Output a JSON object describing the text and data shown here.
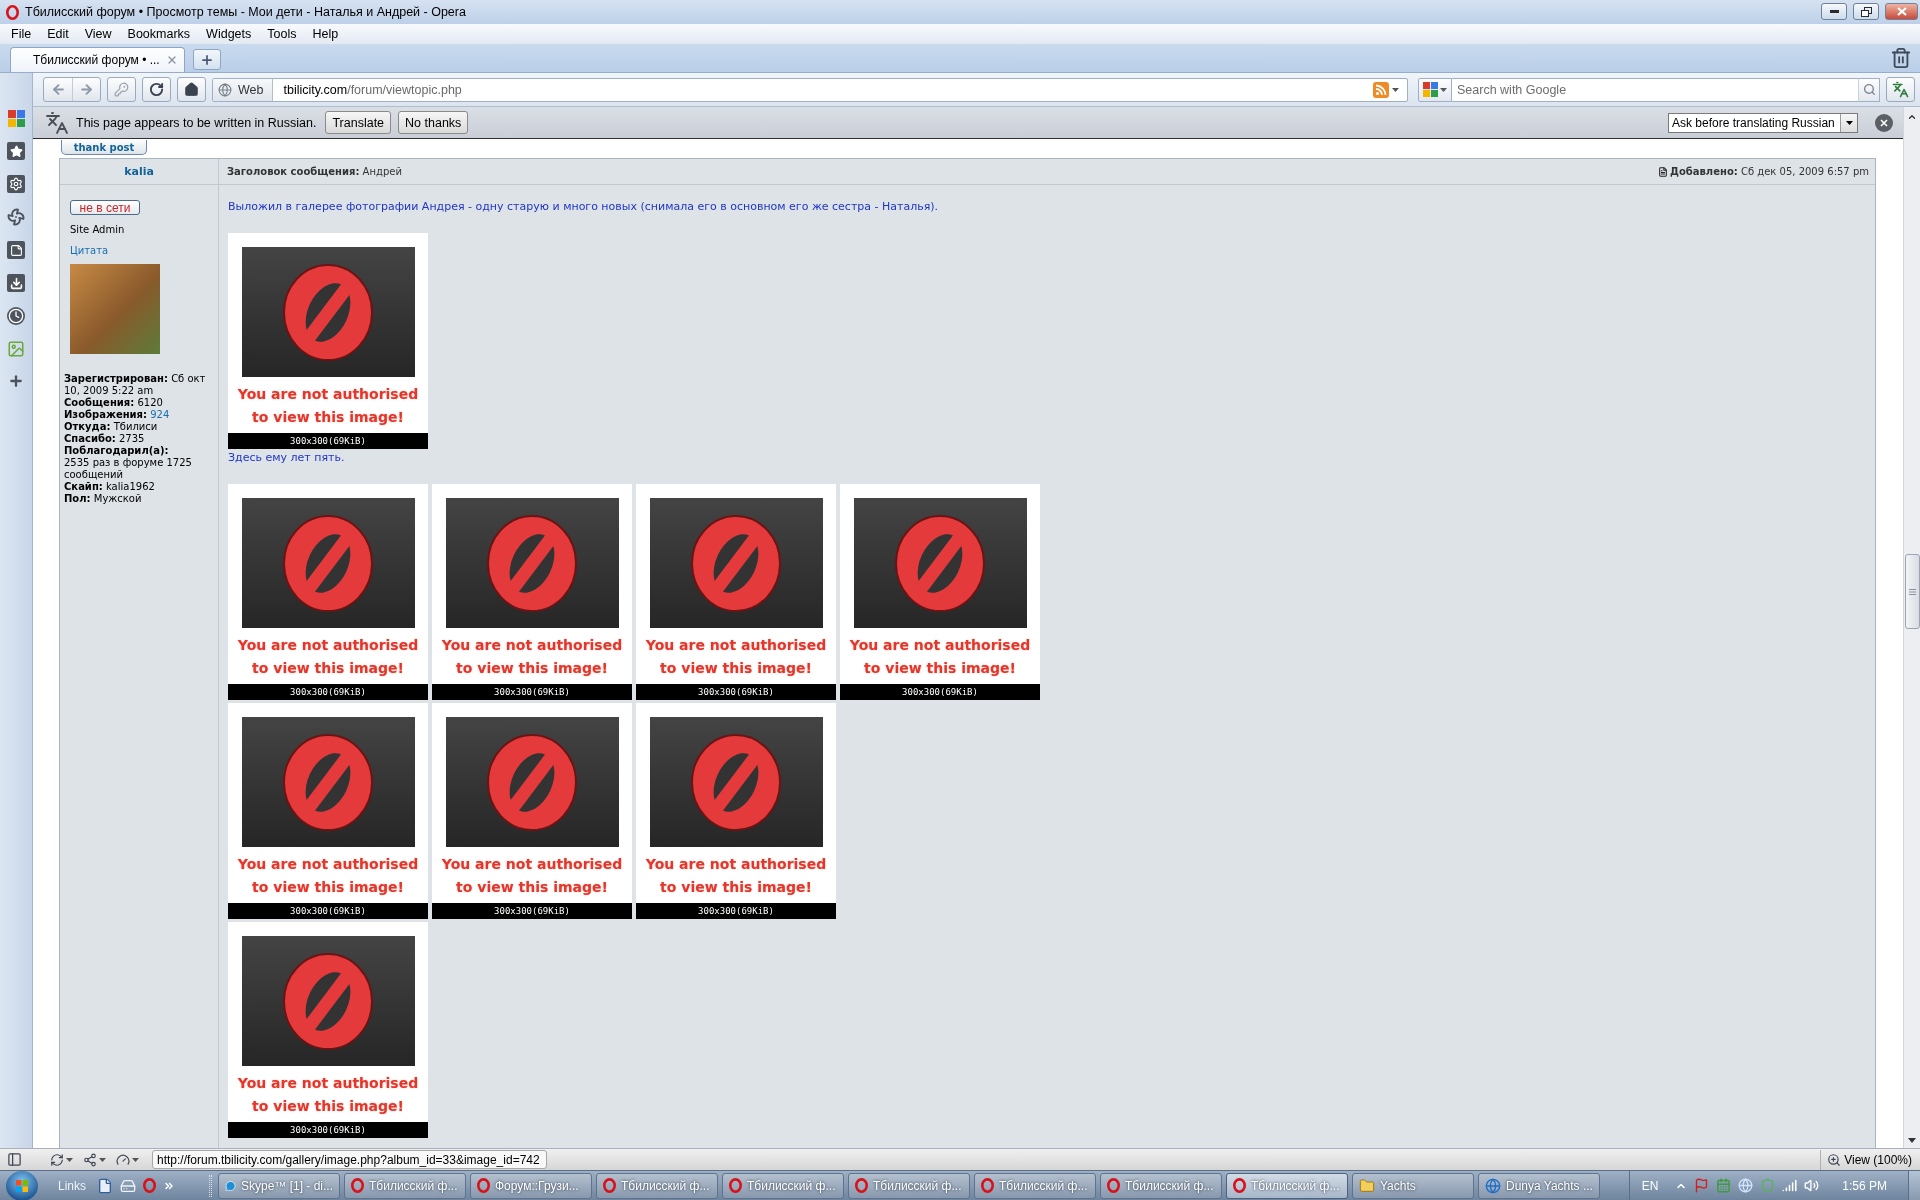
{
  "window": {
    "title": "Тбилисский форум • Просмотр темы - Мои дети - Наталья и Андрей - Opera"
  },
  "menu": [
    "File",
    "Edit",
    "View",
    "Bookmarks",
    "Widgets",
    "Tools",
    "Help"
  ],
  "tabs": [
    {
      "label": "Тбилисский форум • ...",
      "selected": true
    }
  ],
  "address_bar": {
    "badge": "Web",
    "domain": "tbilicity.com",
    "path": "/forum/viewtopic.php"
  },
  "search": {
    "placeholder": "Search with Google"
  },
  "translate_bar": {
    "message": "This page appears to be written in Russian.",
    "buttons": [
      "Translate",
      "No thanks"
    ],
    "option": "Ask before translating Russian"
  },
  "post": {
    "thank_button": "thank post",
    "author": "kalia",
    "status": "не в сети",
    "rank": "Site Admin",
    "quote": "Цитата",
    "stats": [
      {
        "kind": "inline",
        "label": "Зарегистрирован:",
        "value": "Сб окт 10, 2009 5:22 am"
      },
      {
        "kind": "inline",
        "label": "Сообщения:",
        "value": "6120"
      },
      {
        "kind": "link",
        "label": "Изображения:",
        "value": "924"
      },
      {
        "kind": "inline",
        "label": "Откуда:",
        "value": "Тбилиси"
      },
      {
        "kind": "inline",
        "label": "Спасибо:",
        "value": "2735"
      },
      {
        "kind": "block",
        "label": "Поблагодарил(а):",
        "value": "2535 раз в форуме 1725 сообщений"
      },
      {
        "kind": "inline",
        "label": "Скайп:",
        "value": "kalia1962"
      },
      {
        "kind": "inline",
        "label": "Пол:",
        "value": "Мужской"
      }
    ],
    "subject": "**Заголовок сообщения:** Андрей",
    "posted": "**Добавлено:** Сб дек 05, 2009 6:57 pm",
    "body": [
      {
        "kind": "text",
        "text": "Выложил в галерее фотографии Андрея - одну старую и много новых (снимала его в основном его же сестра - Наталья)."
      },
      {
        "kind": "gallery",
        "rows": [
          [
            {
              "notice": "You are not authorised to view this image!",
              "caption": "300x300(69KiB)"
            }
          ]
        ]
      },
      {
        "kind": "text",
        "text": "Здесь ему лет пять."
      },
      {
        "kind": "gallery",
        "rows": [
          [
            {
              "notice": "You are not authorised to view this image!",
              "caption": "300x300(69KiB)"
            },
            {
              "notice": "You are not authorised to view this image!",
              "caption": "300x300(69KiB)"
            },
            {
              "notice": "You are not authorised to view this image!",
              "caption": "300x300(69KiB)"
            },
            {
              "notice": "You are not authorised to view this image!",
              "caption": "300x300(69KiB)"
            }
          ],
          [
            {
              "notice": "You are not authorised to view this image!",
              "caption": "300x300(69KiB)"
            },
            {
              "notice": "You are not authorised to view this image!",
              "caption": "300x300(69KiB)"
            },
            {
              "notice": "You are not authorised to view this image!",
              "caption": "300x300(69KiB)"
            }
          ],
          [
            {
              "notice": "You are not authorised to view this image!",
              "caption": "300x300(69KiB)"
            }
          ]
        ]
      }
    ]
  },
  "status_bar": {
    "url": "http://forum.tbilicity.com/gallery/image.php?album_id=33&image_id=742",
    "zoom": "View (100%)"
  },
  "taskbar": {
    "links": "Links",
    "tasks": [
      {
        "label": "Skype™ [1] - di...",
        "kind": "chat",
        "selected": false
      },
      {
        "label": "Тбилисский ф...",
        "kind": "browser",
        "selected": false
      },
      {
        "label": "Форум::Грузи...",
        "kind": "browser",
        "selected": false
      },
      {
        "label": "Тбилисский ф...",
        "kind": "browser",
        "selected": false
      },
      {
        "label": "Тбилисский ф...",
        "kind": "browser",
        "selected": false
      },
      {
        "label": "Тбилисский ф...",
        "kind": "browser",
        "selected": false
      },
      {
        "label": "Тбилисский ф...",
        "kind": "browser",
        "selected": false
      },
      {
        "label": "Тбилисский ф...",
        "kind": "browser",
        "selected": false
      },
      {
        "label": "Тбилисский ф...",
        "kind": "browser",
        "selected": true
      },
      {
        "label": "Yachts",
        "kind": "folder",
        "selected": false
      },
      {
        "label": "Dunya Yachts ...",
        "kind": "web",
        "selected": false
      }
    ],
    "language": "EN",
    "clock": "1:56 PM"
  }
}
